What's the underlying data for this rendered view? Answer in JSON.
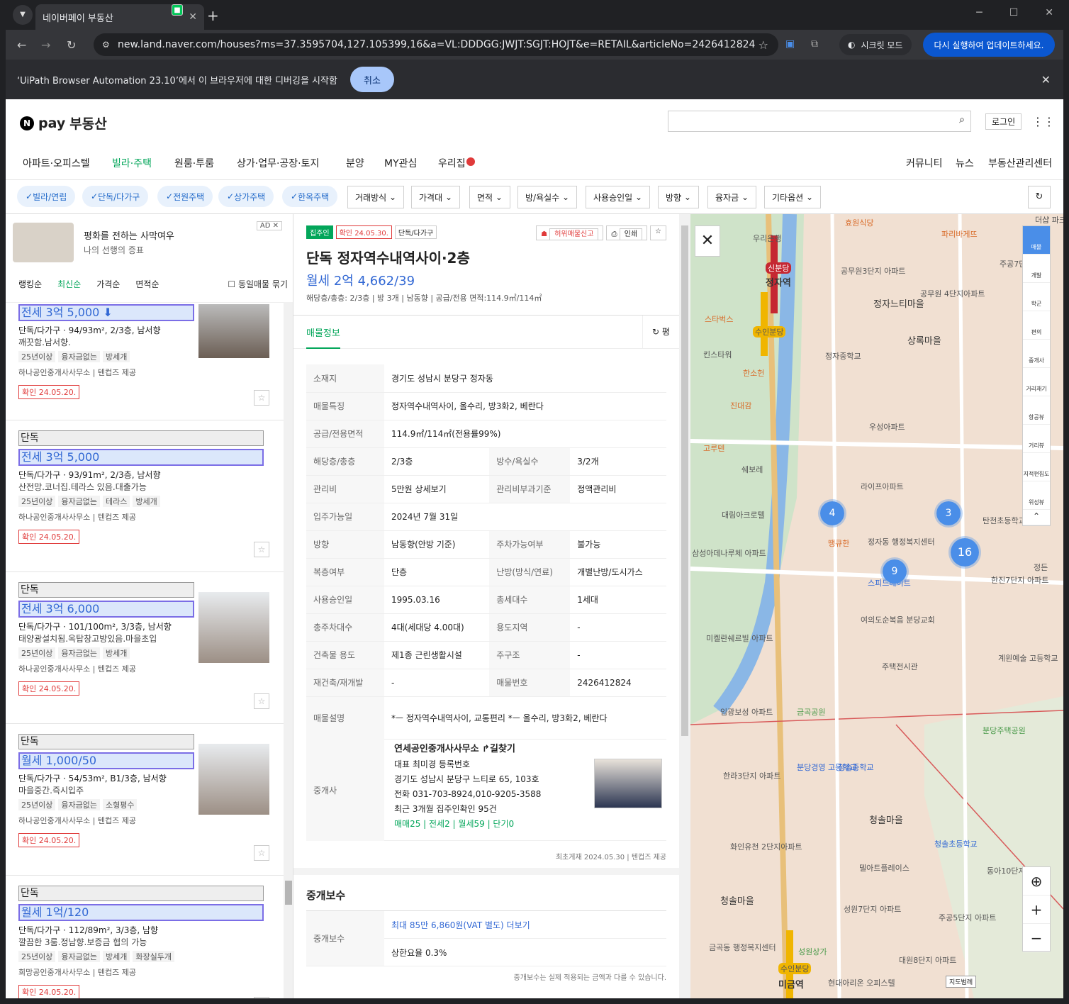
{
  "browser": {
    "tab_title": "네이버페이 부동산",
    "url": "new.land.naver.com/houses?ms=37.3595704,127.105399,16&a=VL:DDDGG:JWJT:SGJT:HOJT&e=RETAIL&articleNo=2426412824",
    "incognito": "시크릿 모드",
    "update": "다시 실행하여 업데이트하세요.",
    "info_text": "‘UiPath Browser Automation 23.10’에서 이 브라우저에 대한 디버깅을 시작함",
    "cancel": "취소"
  },
  "header": {
    "logo_n": "N",
    "logo_pay": "pay",
    "logo_text": "부동산",
    "login": "로그인"
  },
  "gnb": {
    "items": [
      "아파트·오피스텔",
      "빌라·주택",
      "원룸·투룸",
      "상가·업무·공장·토지",
      "분양",
      "MY관심",
      "우리집"
    ],
    "right": [
      "커뮤니티",
      "뉴스",
      "부동산관리센터"
    ]
  },
  "filters": {
    "chips": [
      "빌라/연립",
      "단독/다가구",
      "전원주택",
      "상가주택",
      "한옥주택"
    ],
    "selects": [
      "거래방식",
      "가격대",
      "면적",
      "방/욕실수",
      "사용승인일",
      "방향",
      "융자금",
      "기타옵션"
    ]
  },
  "ad": {
    "title": "평화를 전하는 사막여우",
    "sub": "나의 선행의 증표",
    "tag": "AD"
  },
  "sorts": {
    "items": [
      "랭킹순",
      "최신순",
      "가격순",
      "면적순"
    ],
    "check": "동일매물 묶기"
  },
  "listings": [
    {
      "type": "",
      "price": "전세 3억 5,000",
      "desc": "단독/다가구 · 94/93m², 2/3층, 남서향",
      "note": "깨끗함.남서향.",
      "tags": [
        "25년이상",
        "융자금없는",
        "방세개"
      ],
      "agent": "하나공인중개사사무소 | 텐컵즈 제공",
      "confirm": "확인 24.05.20."
    },
    {
      "type": "단독",
      "price": "전세 3억 5,000",
      "desc": "단독/다가구 · 93/91m², 2/3층, 남서향",
      "note": "산전망.코너집.테라스 있음.대출가능",
      "tags": [
        "25년이상",
        "융자금없는",
        "테라스",
        "방세개"
      ],
      "agent": "하나공인중개사사무소 | 텐컵즈 제공",
      "confirm": "확인 24.05.20."
    },
    {
      "type": "단독",
      "price": "전세 3억 6,000",
      "desc": "단독/다가구 · 101/100m², 3/3층, 남서향",
      "note": "태양광설치됨.옥탑창고방있음.마을초입",
      "tags": [
        "25년이상",
        "융자금없는",
        "방세개"
      ],
      "agent": "하나공인중개사사무소 | 텐컵즈 제공",
      "confirm": "확인 24.05.20."
    },
    {
      "type": "단독",
      "price": "월세 1,000/50",
      "desc": "단독/다가구 · 54/53m², B1/3층, 남서향",
      "note": "마을중간.즉시입주",
      "tags": [
        "25년이상",
        "융자금없는",
        "소형평수"
      ],
      "agent": "하나공인중개사사무소 | 텐컵즈 제공",
      "confirm": "확인 24.05.20."
    },
    {
      "type": "단독",
      "price": "월세 1억/120",
      "desc": "단독/다가구 · 112/89m², 3/3층, 남향",
      "note": "깔끔한 3룸.정남향.보증금 협의 가능",
      "tags": [
        "25년이상",
        "융자금없는",
        "방세개",
        "화장실두개"
      ],
      "agent": "희망공인중개사사무소 | 텐컵즈 제공",
      "confirm": "확인 24.05.20."
    }
  ],
  "detail": {
    "tags": [
      "집주인",
      "확인 24.05.30.",
      "단독/다가구"
    ],
    "actions": [
      "허위매물신고",
      "인쇄"
    ],
    "title": "단독 정자역수내역사이·2층",
    "price": "월세 2억 4,662/39",
    "summary": "해당층/총층: 2/3층 | 방 3개 | 남동향 | 공급/전용 면적:114.9㎡/114㎡",
    "tab": "매물정보",
    "refresh": "평",
    "rows": [
      {
        "k": "소재지",
        "v": "경기도 성남시 분당구 정자동"
      },
      {
        "k": "매물특징",
        "v": "정자역수내역사이, 올수리, 방3화2, 베란다"
      },
      {
        "k": "공급/전용면적",
        "v": "114.9㎡/114㎡(전용률99%)"
      },
      {
        "k": "해당층/총층",
        "v": "2/3층",
        "k2": "방수/욕실수",
        "v2": "3/2개"
      },
      {
        "k": "관리비",
        "v": "5만원 상세보기",
        "k2": "관리비부과기준",
        "v2": "정액관리비"
      },
      {
        "k": "입주가능일",
        "v": "2024년 7월 31일"
      },
      {
        "k": "방향",
        "v": "남동향(안방 기준)",
        "k2": "주차가능여부",
        "v2": "불가능"
      },
      {
        "k": "복층여부",
        "v": "단층",
        "k2": "난방(방식/연료)",
        "v2": "개별난방/도시가스"
      },
      {
        "k": "사용승인일",
        "v": "1995.03.16",
        "k2": "총세대수",
        "v2": "1세대"
      },
      {
        "k": "총주차대수",
        "v": "4대(세대당 4.00대)",
        "k2": "용도지역",
        "v2": "-"
      },
      {
        "k": "건축물 용도",
        "v": "제1종 근린생활시설",
        "k2": "주구조",
        "v2": "-"
      },
      {
        "k": "재건축/재개발",
        "v": "-",
        "k2": "매물번호",
        "v2": "2426412824"
      },
      {
        "k": "매물설명",
        "v": "*ㅡ 정자역수내역사이, 교통편리 *ㅡ 올수리, 방3화2, 베란다"
      }
    ],
    "broker": {
      "k": "중개사",
      "name": "연세공인중개사사무소 ↱길찾기",
      "rep": "대표 최미경 등록번호",
      "addr": "경기도 성남시 분당구 느티로 65, 103호",
      "tel": "전화 031-703-8924,010-9205-3588",
      "recent": "최근 3개월 집주인확인 95건",
      "counts": "매매25 | 전세2 | 월세59 | 단기0"
    },
    "note": "최초게재 2024.05.30 | 텐컵즈 제공",
    "fee_title": "중개보수",
    "fee_rows": [
      {
        "k": "중개보수",
        "v": "최대 85만 6,860원(VAT 별도) 더보기"
      },
      {
        "k": "",
        "v": "상한요율 0.3%"
      }
    ],
    "fee_note": "중개보수는 실제 적용되는 금액과 다를 수 있습니다."
  },
  "map": {
    "labels": [
      "정자역",
      "신분당",
      "수인분당",
      "우리은행",
      "효원식당",
      "파리바게뜨",
      "정자느티마을",
      "상록마을",
      "공무원3단지 아파트",
      "공무원 4단지아파트",
      "주공7단지",
      "스타벅스",
      "킨스타워",
      "한소헌",
      "진대감",
      "정자중학교",
      "우성아파트",
      "고루텐",
      "쉐보레",
      "라이프아파트",
      "대림아크로텔",
      "땡큐한",
      "정자동 행정복지센터",
      "탄천초등학교",
      "삼성아데나루체 아파트",
      "한진7단지 아파트",
      "스피드메이트",
      "여의도순복음 분당교회",
      "미켈란쉐르빌 아파트",
      "주택전시관",
      "계원예술 고등학교",
      "임광보성 아파트",
      "금곡공원",
      "분당주택공원",
      "한라3단지 아파트",
      "분당경영 고등학교",
      "청솔중학교",
      "청솔마을",
      "청솔초등학교",
      "화인유천 2단지아파트",
      "델아트플레이스",
      "동아10단지 아파트",
      "청솔마을",
      "성원7단지 아파트",
      "주공5단지 아파트",
      "금곡동 행정복지센터",
      "성원상가",
      "대원8단지 아파트",
      "수인분당",
      "미금역",
      "현대아리온 오피스텔",
      "정든",
      "더샵 파크"
    ],
    "clusters": [
      "4",
      "3",
      "16",
      "9"
    ],
    "tools": [
      "매물",
      "개발",
      "학군",
      "편의",
      "중개사",
      "거리재기",
      "항공뷰",
      "거리뷰",
      "지적편집도",
      "위성뷰"
    ],
    "scale": "지도범례"
  }
}
